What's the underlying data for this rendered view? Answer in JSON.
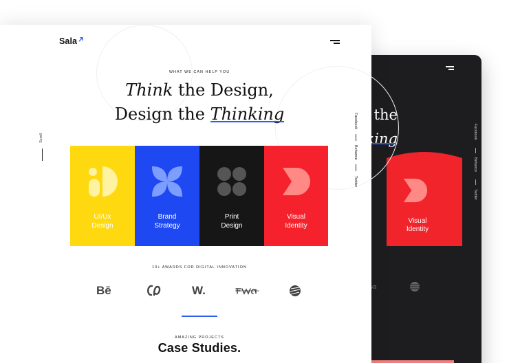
{
  "light": {
    "brand": "Sala",
    "kicker": "WHAT WE CAN HELP YOU",
    "headline": {
      "line1_italic": "Think",
      "line1_rest": " the Design,",
      "line2_rest": "Design the ",
      "line2_italic": "Thinking"
    },
    "scroll_label": "Scroll",
    "social": [
      "Facebook",
      "Behance",
      "Twitter"
    ],
    "cards": [
      {
        "line1": "UI/Ux",
        "line2": "Design",
        "color": "#ffd910"
      },
      {
        "line1": "Brand",
        "line2": "Strategy",
        "color": "#1d48f2"
      },
      {
        "line1": "Print",
        "line2": "Design",
        "color": "#161616"
      },
      {
        "line1": "Visual",
        "line2": "Identity",
        "color": "#f5222d"
      }
    ],
    "awards_kicker": "10+ AWARDS FOR DIGITAL INNOVATION",
    "logos": {
      "behance": "Bē",
      "webby": "W."
    },
    "projects_kicker": "AMAZING PROJECTS",
    "projects_title": "Case Studies."
  },
  "dark": {
    "headline_line1": "ign the",
    "headline_line2": "inking",
    "social": [
      "Facebook",
      "Behance",
      "Twitter"
    ],
    "card": {
      "line1": "Visual",
      "line2": "Identity",
      "color": "#f1232b"
    }
  },
  "colors": {
    "accent": "#2d5cf6",
    "dark_bg": "#1d1d20"
  }
}
